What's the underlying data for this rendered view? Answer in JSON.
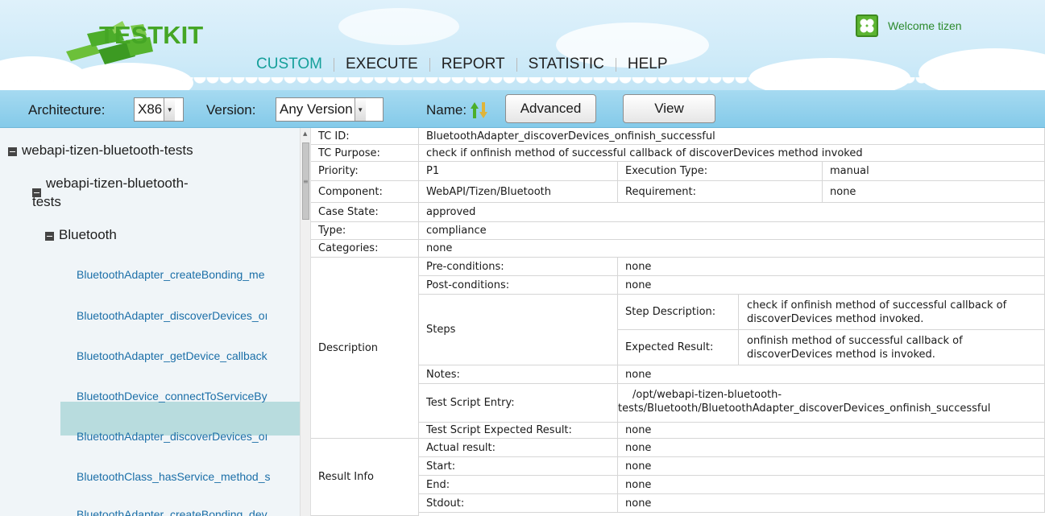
{
  "header": {
    "logo_text": "TESTKIT",
    "welcome": "Welcome tizen",
    "nav": [
      {
        "label": "CUSTOM",
        "active": true
      },
      {
        "label": "EXECUTE",
        "active": false
      },
      {
        "label": "REPORT",
        "active": false
      },
      {
        "label": "STATISTIC",
        "active": false
      },
      {
        "label": "HELP",
        "active": false
      }
    ],
    "colors": {
      "accent": "#159f9a",
      "logo_green": "#45a625",
      "header_bg": "#cdeaf8",
      "toolbar_bg": "#95d2ee"
    }
  },
  "toolbar": {
    "architecture_label": "Architecture:",
    "architecture_value": "X86",
    "version_label": "Version:",
    "version_value": "Any Version",
    "name_label": "Name:",
    "sort_icon": "sort-up-down-icon",
    "advanced_label": "Advanced",
    "view_label": "View"
  },
  "tree": {
    "root": "webapi-tizen-bluetooth-tests",
    "child_line1": "webapi-tizen-bluetooth-",
    "child_line2": "tests",
    "group": "Bluetooth",
    "leaves": [
      "BluetoothAdapter_createBonding_me",
      "BluetoothAdapter_discoverDevices_oı",
      "BluetoothAdapter_getDevice_callback",
      "BluetoothDevice_connectToServiceBy",
      "BluetoothAdapter_discoverDevices_oı",
      "BluetoothClass_hasService_method_s",
      "BluetoothAdapter_createBonding_dev"
    ],
    "selected_index": 4
  },
  "detail": {
    "tc_id_label": "TC ID:",
    "tc_id": "BluetoothAdapter_discoverDevices_onfinish_successful",
    "purpose_label": "TC Purpose:",
    "purpose": "check if onfinish method of successful callback of discoverDevices method invoked",
    "priority_label": "Priority:",
    "priority": "P1",
    "exec_type_label": "Execution Type:",
    "exec_type": "manual",
    "component_label": "Component:",
    "component": "WebAPI/Tizen/Bluetooth",
    "requirement_label": "Requirement:",
    "requirement": "none",
    "case_state_label": "Case State:",
    "case_state": "approved",
    "type_label": "Type:",
    "type": "compliance",
    "categories_label": "Categories:",
    "categories": "none",
    "description_label": "Description",
    "pre_label": "Pre-conditions:",
    "pre": "none",
    "post_label": "Post-conditions:",
    "post": "none",
    "steps_label": "Steps",
    "step_desc_label": "Step Description:",
    "step_desc": "check if onfinish method of successful callback of discoverDevices method invoked.",
    "expected_label": "Expected Result:",
    "expected": "onfinish method of successful callback of discoverDevices method is invoked.",
    "notes_label": "Notes:",
    "notes": "none",
    "entry_label": "Test Script Entry:",
    "entry_line1": "/opt/webapi-tizen-bluetooth-",
    "entry_line2": "tests/Bluetooth/BluetoothAdapter_discoverDevices_onfinish_successful",
    "script_expected_label": "Test Script Expected Result:",
    "script_expected": "none",
    "result_info_label": "Result Info",
    "actual_label": "Actual result:",
    "actual": "none",
    "start_label": "Start:",
    "start": "none",
    "end_label": "End:",
    "end": "none",
    "stdout_label": "Stdout:",
    "stdout": "none"
  }
}
